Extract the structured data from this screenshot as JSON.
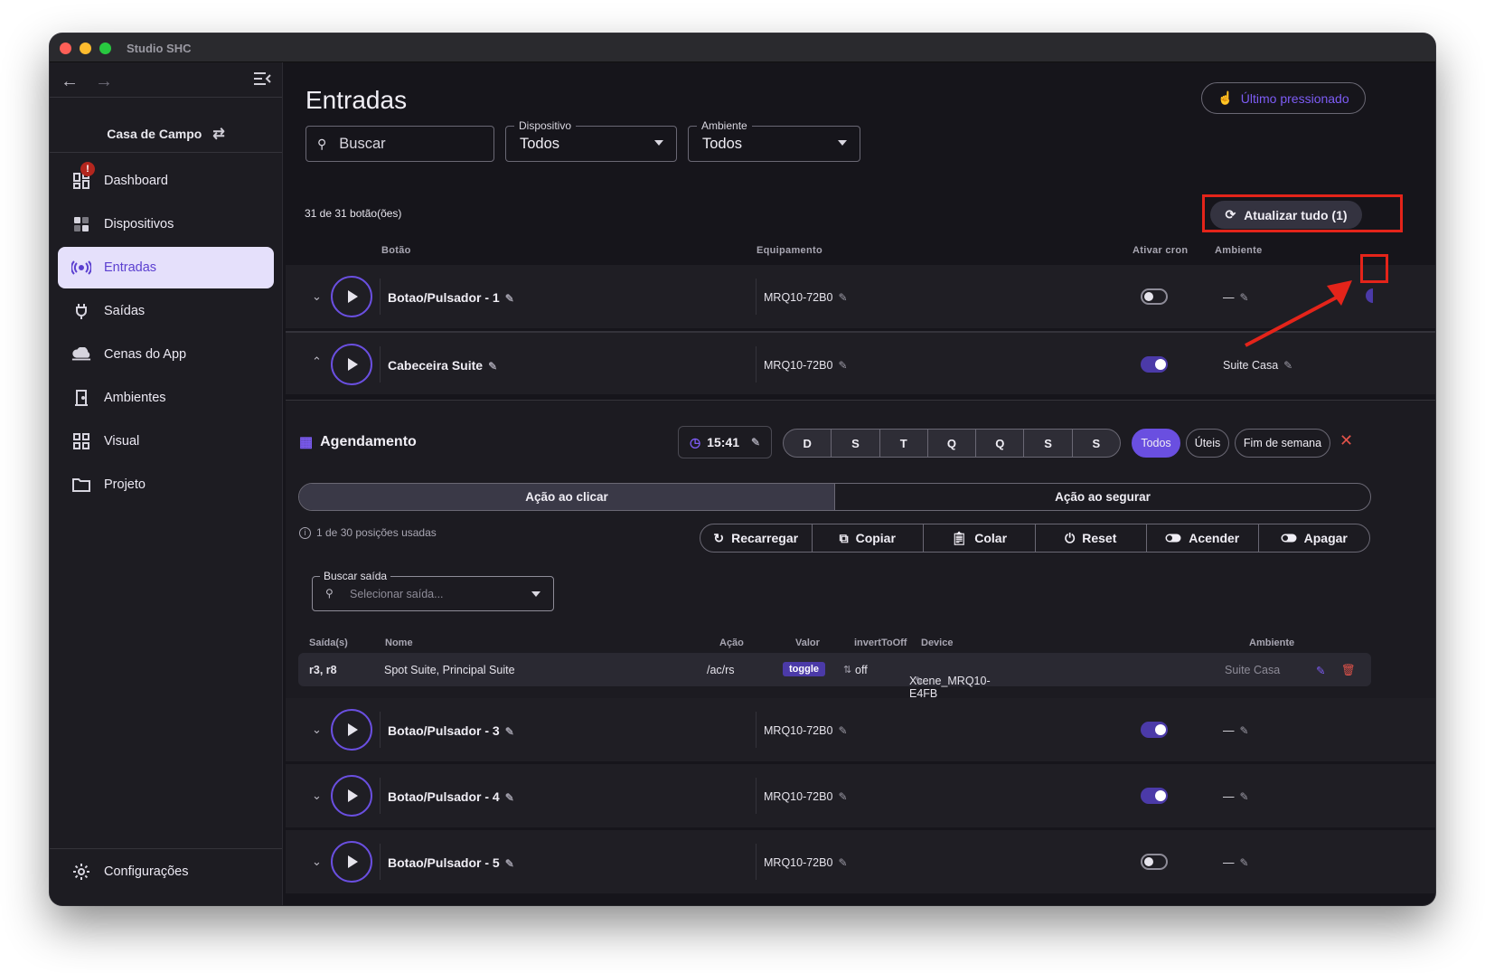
{
  "window": {
    "title": "Studio SHC"
  },
  "sidebar": {
    "house": "Casa de Campo",
    "badge": "!",
    "items": [
      {
        "label": "Dashboard",
        "icon": "dashboard-icon"
      },
      {
        "label": "Dispositivos",
        "icon": "devices-icon"
      },
      {
        "label": "Entradas",
        "icon": "inputs-icon",
        "active": true
      },
      {
        "label": "Saídas",
        "icon": "plug-icon"
      },
      {
        "label": "Cenas do App",
        "icon": "cloud-icon"
      },
      {
        "label": "Ambientes",
        "icon": "door-icon"
      },
      {
        "label": "Visual",
        "icon": "grid-icon"
      },
      {
        "label": "Projeto",
        "icon": "folder-icon"
      }
    ],
    "settings": "Configurações"
  },
  "page": {
    "title": "Entradas",
    "last_pressed": "Último pressionado",
    "search_placeholder": "Buscar",
    "device_label": "Dispositivo",
    "device_value": "Todos",
    "env_label": "Ambiente",
    "env_value": "Todos",
    "count": "31 de 31 botão(ões)",
    "update_all": "Atualizar tudo (1)"
  },
  "columns": {
    "button": "Botão",
    "equipment": "Equipamento",
    "cron": "Ativar cron",
    "env": "Ambiente"
  },
  "rows": [
    {
      "name": "Botao/Pulsador - 1",
      "equip": "MRQ10-72B0",
      "cron": false,
      "env": "—",
      "expanded": false
    },
    {
      "name": "Cabeceira Suite",
      "equip": "MRQ10-72B0",
      "cron": true,
      "env": "Suite Casa",
      "expanded": true
    },
    {
      "name": "Botao/Pulsador - 3",
      "equip": "MRQ10-72B0",
      "cron": true,
      "env": "—",
      "expanded": false
    },
    {
      "name": "Botao/Pulsador - 4",
      "equip": "MRQ10-72B0",
      "cron": true,
      "env": "—",
      "expanded": false
    },
    {
      "name": "Botao/Pulsador - 5",
      "equip": "MRQ10-72B0",
      "cron": false,
      "env": "—",
      "expanded": false
    }
  ],
  "schedule": {
    "title": "Agendamento",
    "time": "15:41",
    "days": [
      "D",
      "S",
      "T",
      "Q",
      "Q",
      "S",
      "S"
    ],
    "presets": [
      "Todos",
      "Úteis",
      "Fim de semana"
    ],
    "selected_preset": "Todos"
  },
  "actions": {
    "tabs": [
      "Ação ao clicar",
      "Ação ao segurar"
    ],
    "active_tab": "Ação ao clicar",
    "usage": "1 de 30 posições usadas",
    "toolbar": [
      "Recarregar",
      "Copiar",
      "Colar",
      "Reset",
      "Acender",
      "Apagar"
    ],
    "search_label": "Buscar saída",
    "search_placeholder": "Selecionar saída..."
  },
  "outputs_table": {
    "headers": [
      "Saída(s)",
      "Nome",
      "Ação",
      "Valor",
      "invertToOff",
      "Device",
      "Ambiente"
    ],
    "rows": [
      {
        "outputs": "r3, r8",
        "name": "Spot Suite, Principal Suite",
        "action": "/ac/rs",
        "value": "toggle",
        "invert": "off",
        "device": "Xcene_MRQ10-E4FB",
        "env": "Suite Casa"
      }
    ]
  },
  "colors": {
    "accent": "#6a4fe0",
    "active_nav_bg": "#e5e0fb",
    "annotation": "#e4241a"
  }
}
